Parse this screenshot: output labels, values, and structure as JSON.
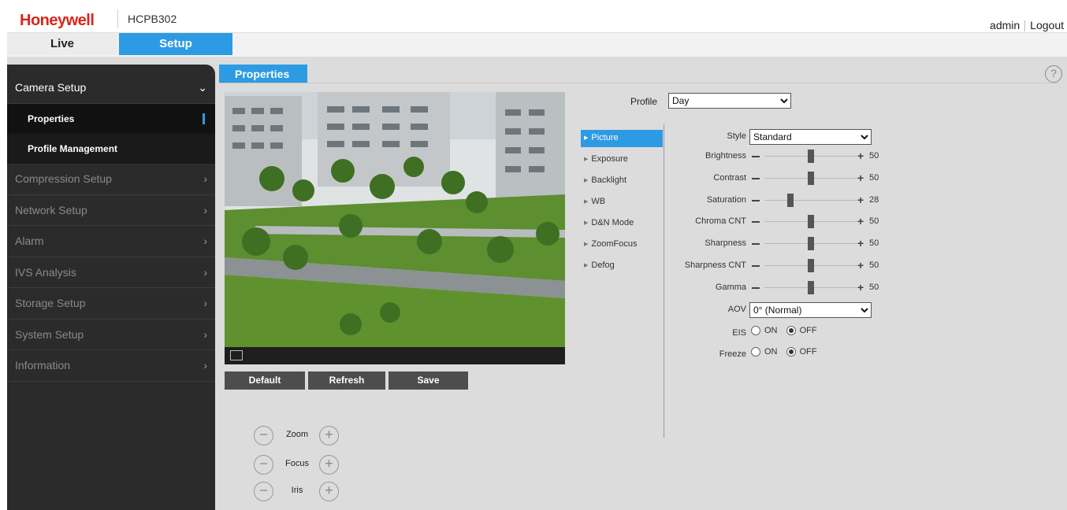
{
  "header": {
    "brand": "Honeywell",
    "model": "HCPB302",
    "user": "admin",
    "logout": "Logout"
  },
  "nav": {
    "live": "Live",
    "setup": "Setup"
  },
  "sidebar": {
    "camera_setup": "Camera Setup",
    "sub_items": [
      "Properties",
      "Profile Management"
    ],
    "items": [
      "Compression Setup",
      "Network Setup",
      "Alarm",
      "IVS Analysis",
      "Storage Setup",
      "System Setup",
      "Information"
    ]
  },
  "main": {
    "tab_title": "Properties",
    "help": "?",
    "buttons": {
      "default": "Default",
      "refresh": "Refresh",
      "save": "Save"
    },
    "lens": {
      "zoom": "Zoom",
      "focus": "Focus",
      "iris": "Iris"
    }
  },
  "profile": {
    "label": "Profile",
    "value": "Day"
  },
  "subnav": [
    "Picture",
    "Exposure",
    "Backlight",
    "WB",
    "D&N Mode",
    "ZoomFocus",
    "Defog"
  ],
  "picture": {
    "style_label": "Style",
    "style_value": "Standard",
    "sliders": [
      {
        "label": "Brightness",
        "value": 50
      },
      {
        "label": "Contrast",
        "value": 50
      },
      {
        "label": "Saturation",
        "value": 28
      },
      {
        "label": "Chroma CNT",
        "value": 50
      },
      {
        "label": "Sharpness",
        "value": 50
      },
      {
        "label": "Sharpness CNT",
        "value": 50
      },
      {
        "label": "Gamma",
        "value": 50
      }
    ],
    "aov_label": "AOV",
    "aov_value": "0° (Normal)",
    "eis_label": "EIS",
    "freeze_label": "Freeze",
    "on": "ON",
    "off": "OFF",
    "eis_state": "OFF",
    "freeze_state": "OFF"
  },
  "colors": {
    "accent": "#2d9be3",
    "brand": "#d9261c",
    "sidebar": "#2b2b2b"
  }
}
